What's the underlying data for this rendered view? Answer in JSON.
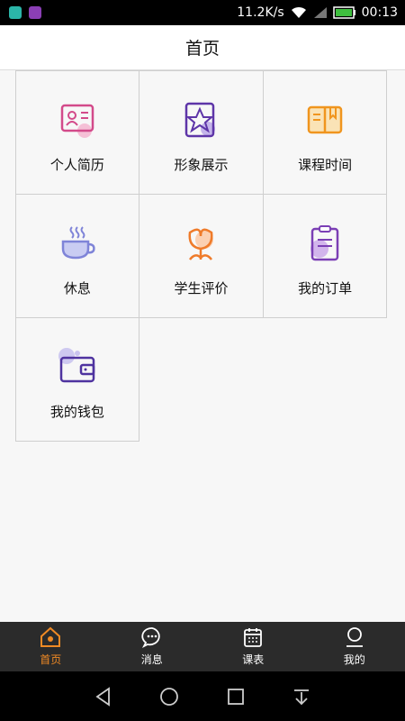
{
  "status": {
    "speed": "11.2K/s",
    "time": "00:13"
  },
  "header": {
    "title": "首页"
  },
  "menu": [
    {
      "label": "个人简历",
      "icon": "resume-icon"
    },
    {
      "label": "形象展示",
      "icon": "star-display-icon"
    },
    {
      "label": "课程时间",
      "icon": "open-book-icon"
    },
    {
      "label": "休息",
      "icon": "coffee-cup-icon"
    },
    {
      "label": "学生评价",
      "icon": "flower-icon"
    },
    {
      "label": "我的订单",
      "icon": "clipboard-icon"
    },
    {
      "label": "我的钱包",
      "icon": "wallet-icon"
    }
  ],
  "tabs": [
    {
      "label": "首页",
      "icon": "home-icon",
      "active": true
    },
    {
      "label": "消息",
      "icon": "message-icon",
      "active": false
    },
    {
      "label": "课表",
      "icon": "calendar-icon",
      "active": false
    },
    {
      "label": "我的",
      "icon": "profile-icon",
      "active": false
    }
  ],
  "colors": {
    "accent": "#f08a24",
    "tabbar": "#2b2b2b"
  }
}
